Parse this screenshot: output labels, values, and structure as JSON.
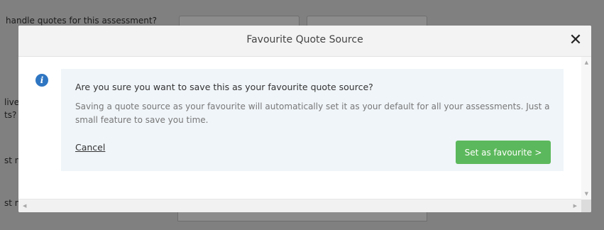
{
  "background": {
    "question_1": "handle quotes for this assessment?",
    "question_2": "live",
    "question_3": "ts?",
    "question_4": "st n",
    "question_5": "st n"
  },
  "modal": {
    "title": "Favourite Quote Source",
    "close_label": "✕",
    "heading": "Are you sure you want to save this as your favourite quote source?",
    "description": "Saving a quote source as your favourite will automatically set it as your default for all your assessments. Just a small feature to save you time.",
    "cancel_label": "Cancel",
    "confirm_label": "Set as favourite >"
  },
  "colors": {
    "confirm_button": "#5cb85c",
    "info_icon": "#2f76c2",
    "panel_background": "#f0f5f9"
  },
  "icons": {
    "info": "info-icon",
    "close": "close-icon"
  }
}
